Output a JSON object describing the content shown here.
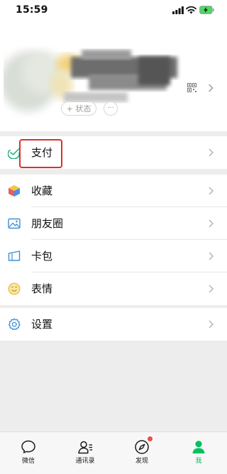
{
  "status_bar": {
    "time": "15:59"
  },
  "profile": {
    "status_label": "+ 状态",
    "more_label": "···"
  },
  "menu": [
    {
      "label": "支付",
      "icon": "pay-icon"
    },
    {
      "label": "收藏",
      "icon": "favorites-icon"
    },
    {
      "label": "朋友圈",
      "icon": "moments-icon"
    },
    {
      "label": "卡包",
      "icon": "card-wallet-icon"
    },
    {
      "label": "表情",
      "icon": "sticker-icon"
    },
    {
      "label": "设置",
      "icon": "settings-icon"
    }
  ],
  "tabs": [
    {
      "label": "微信",
      "icon": "chat-icon",
      "active": false
    },
    {
      "label": "通讯录",
      "icon": "contacts-icon",
      "active": false
    },
    {
      "label": "发现",
      "icon": "discover-icon",
      "active": false,
      "badge": true
    },
    {
      "label": "我",
      "icon": "me-icon",
      "active": true
    }
  ],
  "colors": {
    "accent": "#07c160",
    "highlight": "#d7322c",
    "badge": "#f04b4b",
    "background": "#ededed"
  }
}
